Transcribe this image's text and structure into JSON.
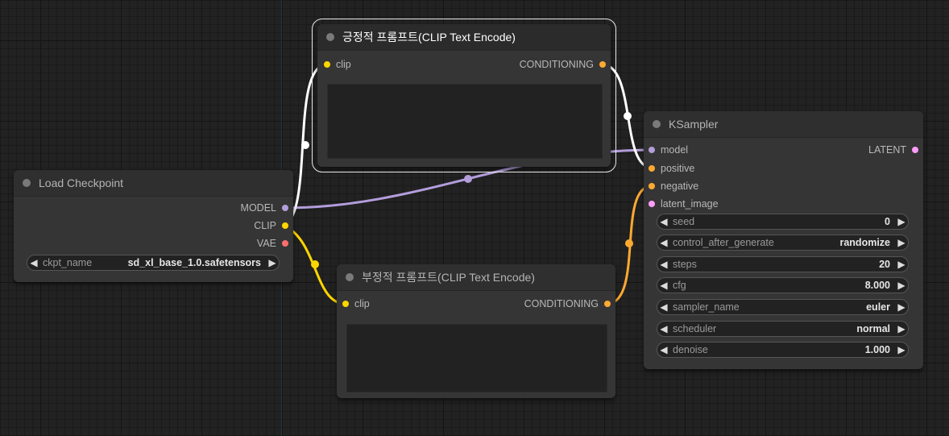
{
  "nodes": {
    "positive": {
      "title": "긍정적 프롬프트(CLIP Text Encode)",
      "input_label": "clip",
      "output_label": "CONDITIONING"
    },
    "negative": {
      "title": "부정적 프롬프트(CLIP Text Encode)",
      "input_label": "clip",
      "output_label": "CONDITIONING"
    },
    "checkpoint": {
      "title": "Load Checkpoint",
      "outputs": [
        "MODEL",
        "CLIP",
        "VAE"
      ],
      "widget": {
        "label": "ckpt_name",
        "value": "sd_xl_base_1.0.safetensors"
      }
    },
    "ksampler": {
      "title": "KSampler",
      "inputs": [
        "model",
        "positive",
        "negative",
        "latent_image"
      ],
      "output_label": "LATENT",
      "widgets": [
        {
          "label": "seed",
          "value": "0"
        },
        {
          "label": "control_after_generate",
          "value": "randomize"
        },
        {
          "label": "steps",
          "value": "20"
        },
        {
          "label": "cfg",
          "value": "8.000"
        },
        {
          "label": "sampler_name",
          "value": "euler"
        },
        {
          "label": "scheduler",
          "value": "normal"
        },
        {
          "label": "denoise",
          "value": "1.000"
        }
      ]
    }
  },
  "colors": {
    "model": "#b39ddb",
    "clip": "#ffd500",
    "vae": "#ff6e6e",
    "conditioning": "#ffa931",
    "latent": "#ff9cf9",
    "selected_link": "#ffffff"
  },
  "icons": {
    "decrement": "left-arrow-icon",
    "increment": "right-arrow-icon"
  }
}
